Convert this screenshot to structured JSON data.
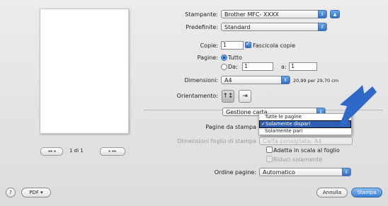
{
  "preview": {
    "page_label": "1 di 1",
    "first_label": "◂◂  ◂",
    "last_label": "▸  ▸▸"
  },
  "printer": {
    "label": "Stampante:",
    "value": "Brother MFC- XXXX"
  },
  "presets": {
    "label": "Predefinite:",
    "value": "Standard"
  },
  "copies": {
    "label": "Copie:",
    "value": "1",
    "collate_label": "Fascicola copie"
  },
  "pages": {
    "label": "Pagine:",
    "all_label": "Tutto",
    "from_label": "Da:",
    "from_value": "1",
    "to_label": "a:",
    "to_value": "1"
  },
  "size": {
    "label": "Dimensioni:",
    "value": "A4",
    "detail": "20,99 per 29,70 cm"
  },
  "orientation": {
    "label": "Orientamento:"
  },
  "panel_popup": {
    "value": "Gestione carta"
  },
  "pages_to_print": {
    "label": "Pagine da stampa"
  },
  "dest_size": {
    "label": "Dimensioni foglio di stampa",
    "value": "Carta consigliata: A4"
  },
  "menu": {
    "items": [
      "Tutte le pagine",
      "Solamente dispari",
      "Solamente pari"
    ],
    "checkmark": "✓"
  },
  "scale": {
    "fit_label": "Adatta in scala al foglio",
    "reduce_label": "Riduci solamente"
  },
  "order": {
    "label": "Ordine pagine:",
    "value": "Automatico"
  },
  "footer": {
    "help": "?",
    "pdf_label": "PDF ▾",
    "cancel_label": "Annulla",
    "print_label": "Stampa"
  },
  "colors": {
    "accent": "#2f6fc3",
    "arrow": "#2f69c7",
    "selection": "#2f5fb3"
  },
  "icons": [
    "help-icon",
    "portrait-icon",
    "landscape-icon",
    "arrow-pointer-icon",
    "disclosure-triangle-icon"
  ]
}
